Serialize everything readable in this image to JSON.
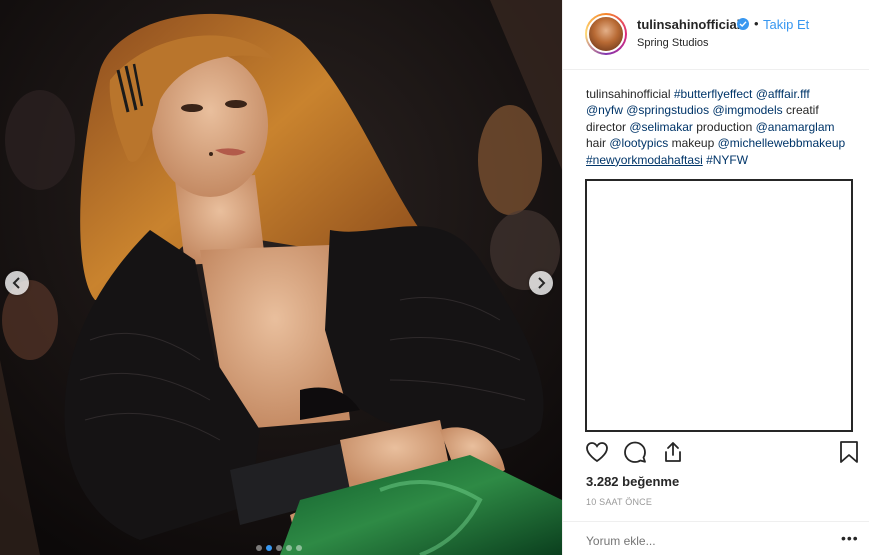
{
  "post": {
    "image_alt": "Model with long auburn hair wearing a black sequined jacket and green satin skirt on a runway",
    "carousel_count": 5,
    "carousel_active": 1
  },
  "header": {
    "username": "tulinsahinofficial",
    "separator": "•",
    "follow_label": "Takip Et",
    "location": "Spring Studios"
  },
  "caption": {
    "username": "tulinsahinofficial",
    "segments": [
      {
        "t": "#butterflyeffect",
        "k": "tag"
      },
      {
        "t": "@afffair.fff",
        "k": "tag"
      },
      {
        "t": "@nyfw",
        "k": "tag"
      },
      {
        "t": "@springstudios",
        "k": "tag"
      },
      {
        "t": "@imgmodels",
        "k": "tag"
      },
      {
        "t": "creatif director",
        "k": "text"
      },
      {
        "t": "@selimakar",
        "k": "tag"
      },
      {
        "t": "production",
        "k": "text"
      },
      {
        "t": "@anamarglam",
        "k": "tag"
      },
      {
        "t": "hair",
        "k": "text"
      },
      {
        "t": "@lootypics",
        "k": "tag"
      },
      {
        "t": "makeup",
        "k": "text"
      },
      {
        "t": "@michellewebbmakeup",
        "k": "tag"
      },
      {
        "t": "#newyorkmodahaftasi",
        "k": "tag-under"
      },
      {
        "t": "#NYFW",
        "k": "tag"
      }
    ]
  },
  "stats": {
    "likes": "3.282 beğenme",
    "time": "10 SAAT ÖNCE"
  },
  "comment": {
    "placeholder": "Yorum ekle...",
    "more": "•••"
  },
  "colors": {
    "accent": "#3897f0",
    "tag": "#003569",
    "text": "#262626",
    "muted": "#999999"
  },
  "icons": {
    "verified": "verified-badge-icon",
    "like": "heart-icon",
    "comment": "comment-bubble-icon",
    "share": "share-icon",
    "save": "bookmark-icon",
    "prev": "chevron-left-icon",
    "next": "chevron-right-icon"
  }
}
